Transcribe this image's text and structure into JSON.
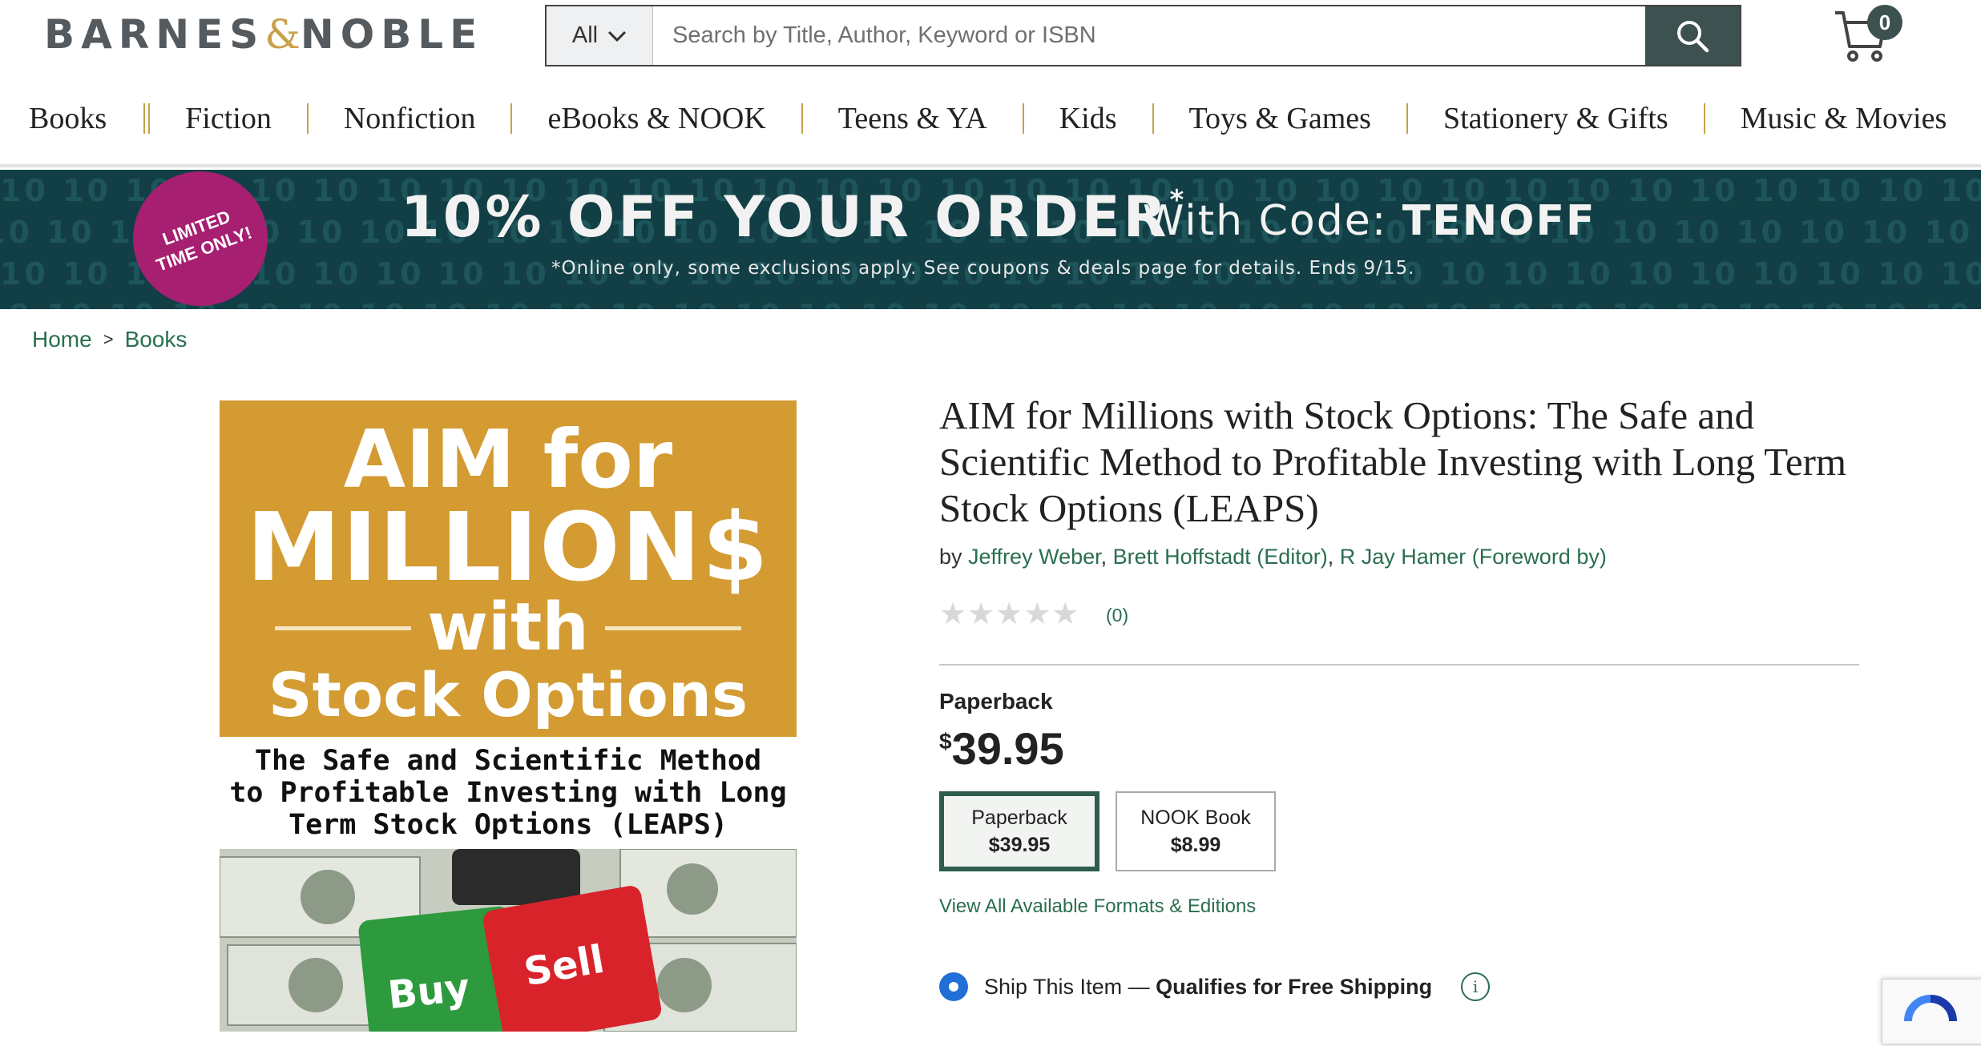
{
  "header": {
    "logo_left": "BARNES",
    "logo_amp": "&",
    "logo_right": "NOBLE",
    "search_category": "All",
    "search_placeholder": "Search by Title, Author, Keyword or ISBN",
    "cart_count": "0"
  },
  "nav": {
    "items": [
      "Books",
      "Fiction",
      "Nonfiction",
      "eBooks & NOOK",
      "Teens & YA",
      "Kids",
      "Toys & Games",
      "Stationery & Gifts",
      "Music & Movies"
    ]
  },
  "promo": {
    "badge_line1": "LIMITED",
    "badge_line2": "TIME ONLY!",
    "headline": "10% OFF YOUR ORDER",
    "asterisk": "*",
    "code_prefix": "With Code: ",
    "code": "TENOFF",
    "disclaimer": "*Online only, some exclusions apply. See coupons & deals page for details. Ends 9/15.",
    "background_text": "10",
    "colors": {
      "background": "#123f45",
      "badge": "#a61f71"
    }
  },
  "breadcrumb": {
    "items": [
      "Home",
      "Books"
    ],
    "separator": ">"
  },
  "cover": {
    "line1": "AIM for",
    "line2": "MILLION$",
    "line3": "with",
    "line4": "Stock Options",
    "sub1": "The Safe and Scientific Method",
    "sub2": "to Profitable Investing with Long",
    "sub3": "Term Stock Options (LEAPS)",
    "key_buy": "Buy",
    "key_sell": "Sell"
  },
  "product": {
    "title": "AIM for Millions with Stock Options: The Safe and Scientific Method to Profitable Investing with Long Term Stock Options (LEAPS)",
    "by": "by ",
    "authors": [
      "Jeffrey Weber",
      "Brett Hoffstadt (Editor)",
      "R Jay Hamer (Foreword by)"
    ],
    "author_sep": ", ",
    "rating": 0,
    "stars": "★★★★★",
    "rating_count": "(0)",
    "format_label": "Paperback",
    "currency": "$",
    "price": "39.95",
    "formats": [
      {
        "name": "Paperback",
        "price": "$39.95",
        "selected": true
      },
      {
        "name": "NOOK Book",
        "price": "$8.99",
        "selected": false
      }
    ],
    "view_all": "View All Available Formats & Editions",
    "ship_label": "Ship This Item — ",
    "ship_bold": "Qualifies for Free Shipping",
    "info_glyph": "i"
  }
}
